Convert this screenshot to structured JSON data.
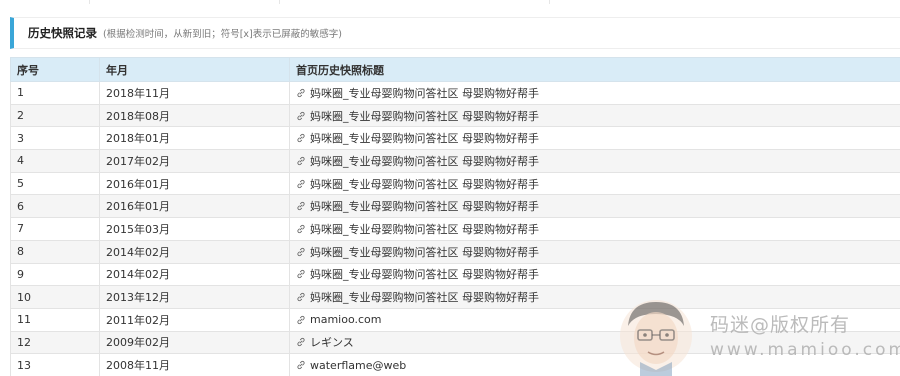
{
  "section": {
    "title": "历史快照记录",
    "note": "(根据检测时间，从新到旧；符号[x]表示已屏蔽的敏感字)"
  },
  "table": {
    "headers": [
      "序号",
      "年月",
      "首页历史快照标题"
    ],
    "rows": [
      {
        "index": "1",
        "date": "2018年11月",
        "title": "妈咪圈_专业母婴购物问答社区 母婴购物好帮手"
      },
      {
        "index": "2",
        "date": "2018年08月",
        "title": "妈咪圈_专业母婴购物问答社区 母婴购物好帮手"
      },
      {
        "index": "3",
        "date": "2018年01月",
        "title": "妈咪圈_专业母婴购物问答社区 母婴购物好帮手"
      },
      {
        "index": "4",
        "date": "2017年02月",
        "title": "妈咪圈_专业母婴购物问答社区 母婴购物好帮手"
      },
      {
        "index": "5",
        "date": "2016年01月",
        "title": "妈咪圈_专业母婴购物问答社区 母婴购物好帮手"
      },
      {
        "index": "6",
        "date": "2016年01月",
        "title": "妈咪圈_专业母婴购物问答社区 母婴购物好帮手"
      },
      {
        "index": "7",
        "date": "2015年03月",
        "title": "妈咪圈_专业母婴购物问答社区 母婴购物好帮手"
      },
      {
        "index": "8",
        "date": "2014年02月",
        "title": "妈咪圈_专业母婴购物问答社区 母婴购物好帮手"
      },
      {
        "index": "9",
        "date": "2014年02月",
        "title": "妈咪圈_专业母婴购物问答社区 母婴购物好帮手"
      },
      {
        "index": "10",
        "date": "2013年12月",
        "title": "妈咪圈_专业母婴购物问答社区 母婴购物好帮手"
      },
      {
        "index": "11",
        "date": "2011年02月",
        "title": "mamioo.com"
      },
      {
        "index": "12",
        "date": "2009年02月",
        "title": "レギンス"
      },
      {
        "index": "13",
        "date": "2008年11月",
        "title": "waterflame@web"
      }
    ]
  },
  "watermark": {
    "line1": "码迷@版权所有",
    "line2": "www.mamioo.com"
  },
  "colors": {
    "accent": "#3aa6d8",
    "header_bg": "#d9ecf7",
    "row_alt": "#f5f5f5"
  },
  "icons": {
    "row_link": "link-icon",
    "watermark": "cartoon-face-icon"
  }
}
